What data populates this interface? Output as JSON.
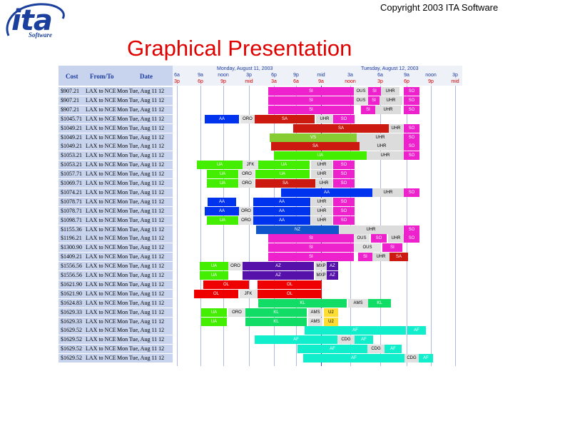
{
  "copyright": "Copyright 2003 ITA Software",
  "logo": {
    "word": "ita",
    "sub": "Software"
  },
  "title": "Graphical Presentation",
  "header": {
    "cost": "Cost",
    "from_to": "From/To",
    "date": "Date"
  },
  "timeline": {
    "day1": "Monday, August 11, 2003",
    "day2": "Tuesday, August 12, 2003",
    "top_ticks": [
      "6a",
      "9a",
      "noon",
      "3p",
      "6p",
      "9p",
      "mid",
      "3a",
      "6a",
      "9a",
      "noon",
      "3p"
    ],
    "bottom_ticks": [
      "3p",
      "6p",
      "9p",
      "mid",
      "3a",
      "6a",
      "9a",
      "noon",
      "3p",
      "6p",
      "9p",
      "mid"
    ]
  },
  "colors": {
    "SI": "#ee22cc",
    "UHR": "#dcdcdc",
    "SO": "#ee22cc",
    "AA": "#0033ee",
    "ORO": "#e4e4e4",
    "SA": "#cc1a10",
    "VS": "#88cc33",
    "UA": "#44ee00",
    "JFK": "#e4e4e4",
    "NZ": "#1155cc",
    "AZ": "#5511aa",
    "MXP": "#dcdcdc",
    "OL": "#ee0000",
    "KL": "#11dd66",
    "AMS": "#e0e0e0",
    "U2": "#ffdd33",
    "AF": "#11eecc",
    "CDG": "#e0e0e0",
    "OUS": "#e4e4e4",
    "label_text": "#ffffff",
    "dark_text": "#000000"
  },
  "rows": [
    {
      "cost": "$907.21",
      "route": "LAX to NCE",
      "date": "Mon Tue, Aug 11 12",
      "segs": [
        [
          "SI",
          376,
          120
        ],
        [
          "OUS",
          496,
          20
        ],
        [
          "SI",
          516,
          18
        ],
        [
          "UHR",
          534,
          26
        ],
        [
          "SO",
          566,
          22
        ]
      ]
    },
    {
      "cost": "$907.21",
      "route": "LAX to NCE",
      "date": "Mon Tue, Aug 11 12",
      "segs": [
        [
          "SI",
          376,
          120
        ],
        [
          "OUS",
          496,
          20
        ],
        [
          "SI",
          516,
          16
        ],
        [
          "UHR",
          532,
          32
        ],
        [
          "SO",
          566,
          22
        ]
      ]
    },
    {
      "cost": "$907.21",
      "route": "LAX to NCE",
      "date": "Mon Tue, Aug 11 12",
      "segs": [
        [
          "SI",
          376,
          120
        ],
        [
          "SI",
          506,
          20
        ],
        [
          "UHR",
          526,
          36
        ],
        [
          "SO",
          566,
          22
        ]
      ]
    },
    {
      "cost": "$1045.71",
      "route": "LAX to NCE",
      "date": "Mon Tue, Aug 11 12",
      "segs": [
        [
          "AA",
          287,
          48
        ],
        [
          "ORO",
          337,
          20
        ],
        [
          "SA",
          357,
          84
        ],
        [
          "UHR",
          443,
          24
        ],
        [
          "SO",
          467,
          30
        ]
      ]
    },
    {
      "cost": "$1049.21",
      "route": "LAX to NCE",
      "date": "Mon Tue, Aug 11 12",
      "segs": [
        [
          "SA",
          411,
          134
        ],
        [
          "UHR",
          545,
          20
        ],
        [
          "SO",
          566,
          22
        ]
      ]
    },
    {
      "cost": "$1049.21",
      "route": "LAX to NCE",
      "date": "Mon Tue, Aug 11 12",
      "segs": [
        [
          "VS",
          378,
          122
        ],
        [
          "UHR",
          500,
          66
        ],
        [
          "SO",
          566,
          22
        ]
      ]
    },
    {
      "cost": "$1049.21",
      "route": "LAX to NCE",
      "date": "Mon Tue, Aug 11 12",
      "segs": [
        [
          "SA",
          380,
          124
        ],
        [
          "UHR",
          504,
          62
        ],
        [
          "SO",
          566,
          22
        ]
      ]
    },
    {
      "cost": "$1053.21",
      "route": "LAX to NCE",
      "date": "Mon Tue, Aug 11 12",
      "segs": [
        [
          "UA",
          384,
          130
        ],
        [
          "UHR",
          514,
          52
        ],
        [
          "SO",
          566,
          22
        ]
      ]
    },
    {
      "cost": "$1053.21",
      "route": "LAX to NCE",
      "date": "Mon Tue, Aug 11 12",
      "segs": [
        [
          "UA",
          276,
          64
        ],
        [
          "JFK",
          340,
          22
        ],
        [
          "UA",
          362,
          72
        ],
        [
          "UHR",
          436,
          30
        ],
        [
          "SO",
          467,
          30
        ]
      ]
    },
    {
      "cost": "$1057.71",
      "route": "LAX to NCE",
      "date": "Mon Tue, Aug 11 12",
      "segs": [
        [
          "UA",
          290,
          44
        ],
        [
          "ORO",
          335,
          22
        ],
        [
          "UA",
          358,
          76
        ],
        [
          "UHR",
          436,
          30
        ],
        [
          "SO",
          467,
          30
        ]
      ]
    },
    {
      "cost": "$1069.71",
      "route": "LAX to NCE",
      "date": "Mon Tue, Aug 11 12",
      "segs": [
        [
          "UA",
          290,
          44
        ],
        [
          "ORO",
          335,
          22
        ],
        [
          "SA",
          358,
          84
        ],
        [
          "UHR",
          442,
          24
        ],
        [
          "SO",
          467,
          30
        ]
      ]
    },
    {
      "cost": "$1074.21",
      "route": "LAX to NCE",
      "date": "Mon Tue, Aug 11 12",
      "segs": [
        [
          "AA",
          394,
          128
        ],
        [
          "UHR",
          522,
          44
        ],
        [
          "SO",
          566,
          22
        ]
      ]
    },
    {
      "cost": "$1078.71",
      "route": "LAX to NCE",
      "date": "Mon Tue, Aug 11 12",
      "segs": [
        [
          "AA",
          291,
          40
        ],
        [
          "AA",
          355,
          80
        ],
        [
          "UHR",
          436,
          30
        ],
        [
          "SO",
          467,
          30
        ]
      ]
    },
    {
      "cost": "$1078.71",
      "route": "LAX to NCE",
      "date": "Mon Tue, Aug 11 12",
      "segs": [
        [
          "AA",
          287,
          48
        ],
        [
          "ORO",
          335,
          20
        ],
        [
          "AA",
          355,
          80
        ],
        [
          "UHR",
          436,
          30
        ],
        [
          "SO",
          467,
          30
        ]
      ]
    },
    {
      "cost": "$1098.71",
      "route": "LAX to NCE",
      "date": "Mon Tue, Aug 11 12",
      "segs": [
        [
          "UA",
          290,
          44
        ],
        [
          "ORO",
          335,
          20
        ],
        [
          "AA",
          355,
          80
        ],
        [
          "UHR",
          436,
          30
        ],
        [
          "SO",
          467,
          30
        ]
      ]
    },
    {
      "cost": "$1155.36",
      "route": "LAX to NCE",
      "date": "Mon Tue, Aug 11 12",
      "segs": [
        [
          "NZ",
          359,
          116
        ],
        [
          "UHR",
          475,
          90
        ],
        [
          "SO",
          566,
          22
        ]
      ]
    },
    {
      "cost": "$1196.21",
      "route": "LAX to NCE",
      "date": "Mon Tue, Aug 11 12",
      "segs": [
        [
          "SI",
          376,
          120
        ],
        [
          "OUS",
          496,
          22
        ],
        [
          "SO",
          520,
          22
        ],
        [
          "UHR",
          544,
          22
        ],
        [
          "SO",
          566,
          22
        ]
      ]
    },
    {
      "cost": "$1300.90",
      "route": "LAX to NCE",
      "date": "Mon Tue, Aug 11 12",
      "segs": [
        [
          "SI",
          376,
          120
        ],
        [
          "OUS",
          496,
          38
        ],
        [
          "SI",
          536,
          28
        ]
      ]
    },
    {
      "cost": "$1409.21",
      "route": "LAX to NCE",
      "date": "Mon Tue, Aug 11 12",
      "segs": [
        [
          "SI",
          376,
          120
        ],
        [
          "SI",
          502,
          20
        ],
        [
          "UHR",
          522,
          24
        ],
        [
          "SA",
          546,
          26
        ]
      ]
    },
    {
      "cost": "$1556.56",
      "route": "LAX to NCE",
      "date": "Mon Tue, Aug 11 12",
      "segs": [
        [
          "UA",
          280,
          40
        ],
        [
          "ORO",
          320,
          20
        ],
        [
          "AZ",
          340,
          100
        ],
        [
          "MXP",
          442,
          16
        ],
        [
          "AZ",
          458,
          16
        ]
      ]
    },
    {
      "cost": "$1556.56",
      "route": "LAX to NCE",
      "date": "Mon Tue, Aug 11 12",
      "segs": [
        [
          "UA",
          280,
          40
        ],
        [
          "AZ",
          340,
          100
        ],
        [
          "MXP",
          442,
          16
        ],
        [
          "AZ",
          458,
          16
        ]
      ]
    },
    {
      "cost": "$1621.90",
      "route": "LAX to NCE",
      "date": "Mon Tue, Aug 11 12",
      "segs": [
        [
          "OL",
          285,
          64
        ],
        [
          "OL",
          361,
          90
        ]
      ]
    },
    {
      "cost": "$1621.90",
      "route": "LAX to NCE",
      "date": "Mon Tue, Aug 11 12",
      "segs": [
        [
          "OL",
          272,
          62
        ],
        [
          "JFK",
          336,
          24
        ],
        [
          "OL",
          361,
          90
        ]
      ]
    },
    {
      "cost": "$1624.83",
      "route": "LAX to NCE",
      "date": "Mon Tue, Aug 11 12",
      "segs": [
        [
          "KL",
          362,
          124
        ],
        [
          "AMS",
          488,
          28
        ],
        [
          "KL",
          516,
          32
        ]
      ]
    },
    {
      "cost": "$1629.33",
      "route": "LAX to NCE",
      "date": "Mon Tue, Aug 11 12",
      "segs": [
        [
          "UA",
          282,
          36
        ],
        [
          "ORO",
          320,
          24
        ],
        [
          "KL",
          344,
          86
        ],
        [
          "AMS",
          432,
          20
        ],
        [
          "U2",
          454,
          20
        ]
      ]
    },
    {
      "cost": "$1629.33",
      "route": "LAX to NCE",
      "date": "Mon Tue, Aug 11 12",
      "segs": [
        [
          "UA",
          282,
          36
        ],
        [
          "KL",
          344,
          86
        ],
        [
          "AMS",
          432,
          20
        ],
        [
          "U2",
          454,
          20
        ]
      ]
    },
    {
      "cost": "$1629.52",
      "route": "LAX to NCE",
      "date": "Mon Tue, Aug 11 12",
      "segs": [
        [
          "AF",
          427,
          142
        ],
        [
          "AF",
          571,
          26
        ]
      ]
    },
    {
      "cost": "$1629.52",
      "route": "LAX to NCE",
      "date": "Mon Tue, Aug 11 12",
      "segs": [
        [
          "AF",
          357,
          116
        ],
        [
          "CDG",
          473,
          24
        ],
        [
          "AF",
          497,
          26
        ]
      ]
    },
    {
      "cost": "$1629.52",
      "route": "LAX to NCE",
      "date": "Mon Tue, Aug 11 12",
      "segs": [
        [
          "AF",
          417,
          98
        ],
        [
          "CDG",
          515,
          24
        ],
        [
          "AF",
          539,
          24
        ]
      ]
    },
    {
      "cost": "$1629.52",
      "route": "LAX to NCE",
      "date": "Mon Tue, Aug 11 12",
      "segs": [
        [
          "AF",
          425,
          142
        ],
        [
          "CDG",
          567,
          20
        ],
        [
          "AF",
          587,
          20
        ]
      ]
    }
  ]
}
